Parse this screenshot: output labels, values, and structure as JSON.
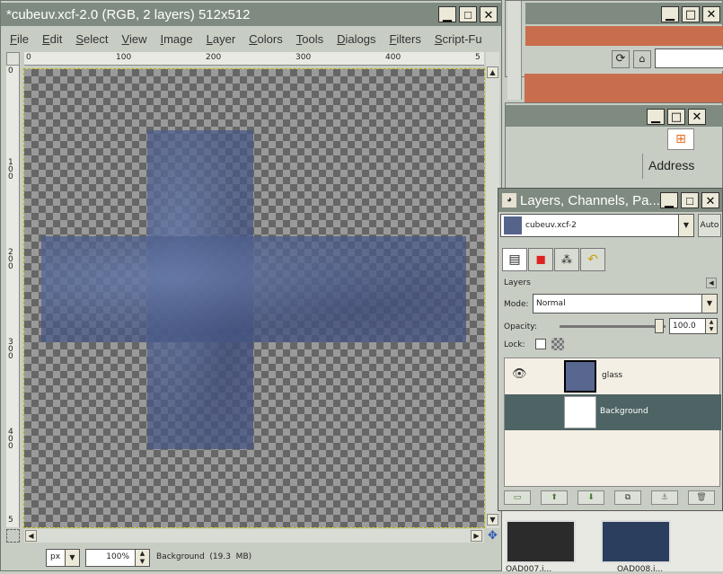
{
  "image_window": {
    "title": "*cubeuv.xcf-2.0 (RGB, 2 layers) 512x512",
    "menu": [
      "File",
      "Edit",
      "Select",
      "View",
      "Image",
      "Layer",
      "Colors",
      "Tools",
      "Dialogs",
      "Filters",
      "Script-Fu"
    ],
    "ruler_h_ticks": [
      "0",
      "100",
      "200",
      "300",
      "400",
      "5"
    ],
    "ruler_v_ticks": [
      "0",
      "1\n0\n0",
      "2\n0\n0",
      "3\n0\n0",
      "4\n0\n0",
      "5"
    ],
    "status": {
      "unit": "px",
      "zoom": "100%",
      "info": "Background  (19.3  MB)"
    }
  },
  "background_windows": {
    "address_label": "Address"
  },
  "layers_dialog": {
    "title": "Layers, Channels, Pa...",
    "image_menu": "cubeuv.xcf-2",
    "auto_label": "Auto",
    "section_label": "Layers",
    "mode_label": "Mode:",
    "mode_value": "Normal",
    "opacity_label": "Opacity:",
    "opacity_value": "100.0",
    "lock_label": "Lock:",
    "layers": [
      {
        "name": "glass",
        "selected": false
      },
      {
        "name": "Background",
        "selected": true
      }
    ]
  },
  "thumbnails": [
    "OAD007.i...",
    "OAD008.i..."
  ],
  "colors": {
    "titlebar": "#7f8b80",
    "selected_layer": "#4e6464",
    "accent_orange": "#c86e4c"
  }
}
